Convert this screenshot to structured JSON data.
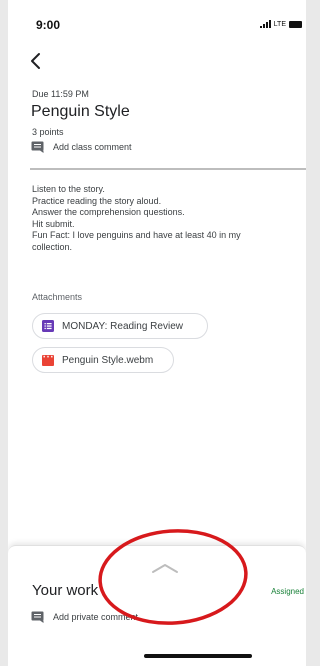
{
  "status_bar": {
    "time": "9:00",
    "network": "LTE"
  },
  "assignment": {
    "due": "Due 11:59 PM",
    "title": "Penguin Style",
    "points": "3 points",
    "class_comment_label": "Add class comment",
    "instructions": [
      "Listen to the story.",
      "Practice reading the story aloud.",
      "Answer the comprehension questions.",
      "Hit submit.",
      "Fun Fact: I love penguins and have at least 40 in my\ncollection."
    ]
  },
  "attachments": {
    "label": "Attachments",
    "items": [
      {
        "label": "MONDAY: Reading Review",
        "icon": "forms-icon",
        "color": "#673ab7"
      },
      {
        "label": "Penguin Style.webm",
        "icon": "video-icon",
        "color": "#ea4335"
      }
    ]
  },
  "your_work": {
    "title": "Your work",
    "status": "Assigned",
    "status_color": "#188038",
    "private_comment_label": "Add private comment"
  },
  "annotation": {
    "shape": "ellipse",
    "color": "#d7191c"
  }
}
